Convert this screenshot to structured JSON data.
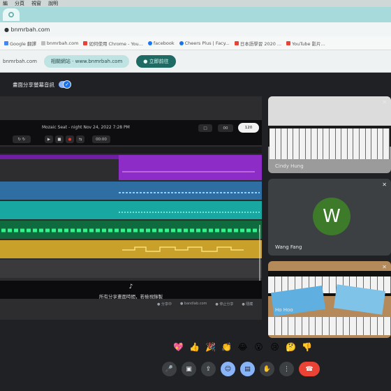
{
  "browser": {
    "menu": [
      "編",
      "分頁",
      "視窗",
      "說明"
    ],
    "address": "● bnmrbah.com",
    "bookmarks": [
      {
        "label": "Google 翻譯",
        "color": "#4285f4"
      },
      {
        "label": "bnmrbah.com",
        "color": "#e0e0e0"
      },
      {
        "label": "如何使用 Chrome - You...",
        "color": "#ea4335"
      },
      {
        "label": "facebook",
        "color": "#1877f2"
      },
      {
        "label": "Cheers Plus | Facy...",
        "color": "#1a73e8"
      },
      {
        "label": "日本語學習 2020 ...",
        "color": "#ea4335"
      },
      {
        "label": "YouTube 影片...",
        "color": "#ea4335"
      }
    ],
    "info_site": "bnmrbah.com",
    "info_pill_light": "相關網站 · www.bnmrbah.com",
    "info_pill_dark": "● 立即前往"
  },
  "meet": {
    "share_banner": "畫面分享螢幕音訊",
    "toggle_check": "✓",
    "daw": {
      "title": "Mozaic Seat - night Nov 24, 2022 7:28 PM",
      "buttons_left": [
        "↻ ↻"
      ],
      "transport": [
        "▶",
        "■",
        "●",
        "⇆",
        "□"
      ],
      "counter_left": "00:00",
      "counter_right": "00",
      "tempo": "120",
      "caption_icon": "♪",
      "caption": "所有分享畫面時間，若檢視錄製",
      "footer": [
        "● 分享中",
        "● bandlab.com",
        "● 停止分享",
        "● 隱藏"
      ]
    },
    "participants": [
      {
        "name": "Cindy Hung"
      },
      {
        "name": "Wang Fang",
        "initial": "W"
      },
      {
        "name": "Ho Hoo"
      }
    ],
    "reactions": [
      "💖",
      "👍",
      "🎉",
      "👏",
      "😂",
      "😮",
      "😢",
      "🤔",
      "👎"
    ],
    "controls": [
      {
        "icon": "mic-icon",
        "glyph": "🎤"
      },
      {
        "icon": "camera-icon",
        "glyph": "▣"
      },
      {
        "icon": "present-icon",
        "glyph": "⇪"
      },
      {
        "icon": "emoji-icon",
        "glyph": "☺"
      },
      {
        "icon": "screen-share-icon",
        "glyph": "▤"
      },
      {
        "icon": "raise-hand-icon",
        "glyph": "✋"
      },
      {
        "icon": "more-icon",
        "glyph": "⋮"
      },
      {
        "icon": "hang-up-icon",
        "glyph": "☎"
      }
    ],
    "colors": {
      "track_purple": "#8e2cc7",
      "track_blue": "#2e6ea3",
      "track_teal": "#19a7a1",
      "track_green": "#1ec46a",
      "track_yellow": "#c9a02a",
      "avatar_bg": "#3d7a2a",
      "hang_up": "#ea4335"
    }
  }
}
